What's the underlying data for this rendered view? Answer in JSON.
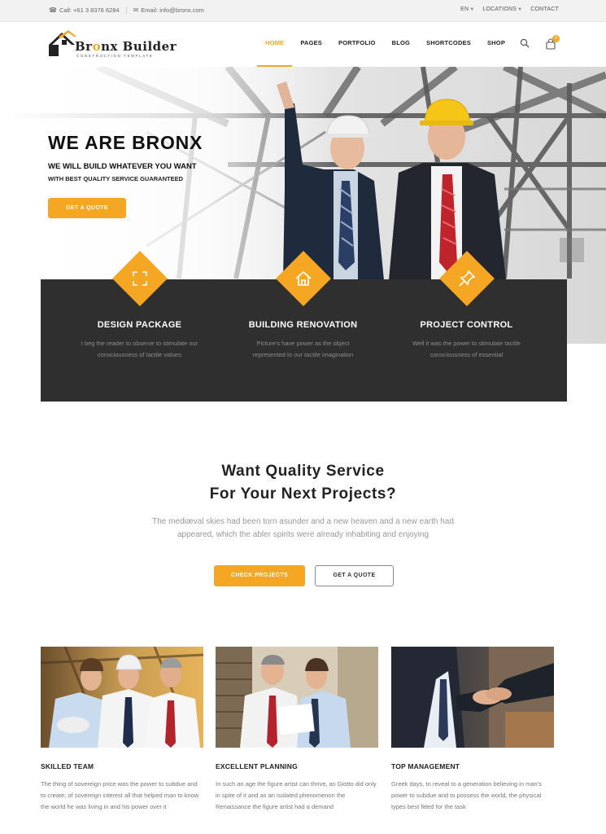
{
  "topbar": {
    "phone": "Call: +61 3 8376 6284",
    "email": "Email: info@bronx.com",
    "language": "EN",
    "locations": "LOCATIONS",
    "contact": "CONTACT"
  },
  "brand": {
    "name_part1": "Br",
    "name_o": "o",
    "name_part2": "nx Builder",
    "tagline": "CONSTRUCTION TEMPLATE"
  },
  "nav": {
    "items": [
      "HOME",
      "PAGES",
      "PORTFOLIO",
      "BLOG",
      "SHORTCODES",
      "SHOP"
    ],
    "active": "HOME"
  },
  "cart": {
    "count": "0"
  },
  "hero": {
    "title": "WE ARE BRONX",
    "subtitle1": "WE WILL BUILD WHATEVER YOU WANT",
    "subtitle2": "WITH BEST QUALITY SERVICE GUARANTEED",
    "button": "GET A QUOTE"
  },
  "features": [
    {
      "icon": "expand-icon",
      "title": "DESIGN PACKAGE",
      "desc": "I beg the reader to observe to stimulate our consciousness of tactile values"
    },
    {
      "icon": "home-icon",
      "title": "BUILDING RENOVATION",
      "desc": "Picture's have power as the object represented to our tactile imagination"
    },
    {
      "icon": "pin-icon",
      "title": "PROJECT CONTROL",
      "desc": "Well it was the power to stimulate tactile consciousness of essential"
    }
  ],
  "quality": {
    "title_line1": "Want Quality Service",
    "title_line2": "For Your Next Projects?",
    "text": "The mediæval skies had been torn asunder and a new heaven and a new earth had appeared, which the abler spirits were already inhabiting and enjoying",
    "btn_projects": "CHECK PROJECTS",
    "btn_quote": "GET A QUOTE"
  },
  "cards": [
    {
      "title": "SKILLED TEAM",
      "text": "The thing of sovereign price was the power to subdue and to create; of sovereign interest all that helped man to know the world he was living in and his power over it"
    },
    {
      "title": "EXCELLENT PLANNING",
      "text": "In such an age the figure artist can thrive, as Giotto did only in spite of it and as an isolated phenomenon the Renaissance the figure artist had a demand"
    },
    {
      "title": "TOP MANAGEMENT",
      "text": "Greek days, to reveal to a generation believing in man's power to subdue and to possess the world, the physical types best fitted for the task"
    }
  ],
  "colors": {
    "accent": "#f5a623",
    "dark": "#2f2f2f"
  }
}
